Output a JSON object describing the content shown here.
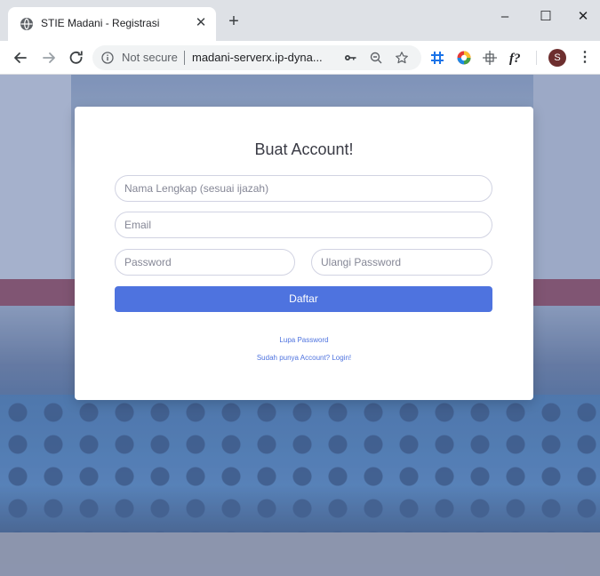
{
  "browser": {
    "tab_title": "STIE Madani - Registrasi",
    "tab_close": "✕",
    "new_tab": "+",
    "window_controls": {
      "minimize": "–",
      "maximize": "☐",
      "close": "✕"
    },
    "security_label": "Not secure",
    "url": "madani-serverx.ip-dyna...",
    "profile_initial": "S",
    "menu": "⋮"
  },
  "icons": {
    "favicon": "globe-icon",
    "back": "back-arrow-icon",
    "forward": "forward-arrow-icon",
    "reload": "reload-icon",
    "info": "info-icon",
    "key": "key-icon",
    "zoom": "zoom-icon",
    "bookmark": "star-icon"
  },
  "colors": {
    "primary": "#4e73df",
    "title": "#3a3b45",
    "input_border": "#d1d3e2"
  },
  "form": {
    "title": "Buat Account!",
    "fullname_placeholder": "Nama Lengkap (sesuai ijazah)",
    "email_placeholder": "Email",
    "password_placeholder": "Password",
    "repeat_password_placeholder": "Ulangi Password",
    "submit_label": "Daftar",
    "forgot_password_link": "Lupa Password",
    "login_link": "Sudah punya Account? Login!"
  }
}
